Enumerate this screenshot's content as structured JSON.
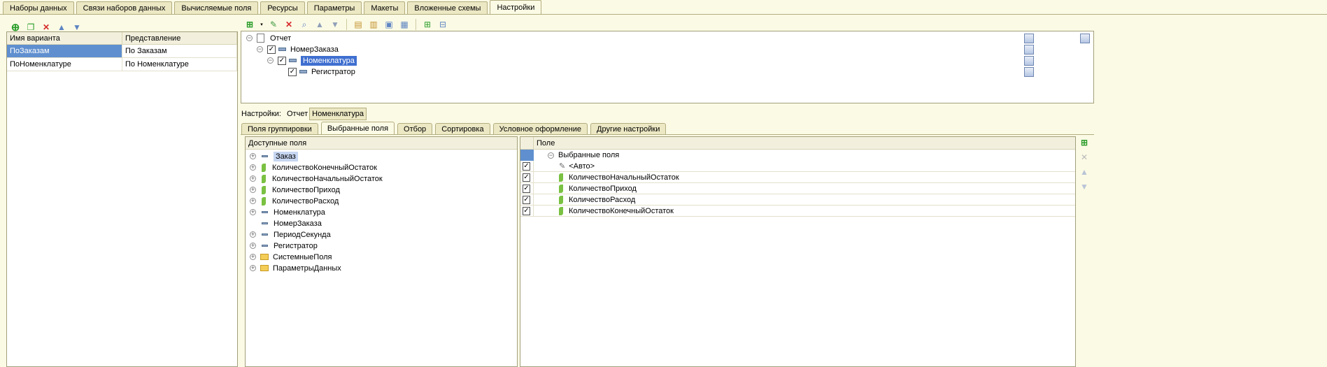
{
  "top_tabs": [
    "Наборы данных",
    "Связи наборов данных",
    "Вычисляемые поля",
    "Ресурсы",
    "Параметры",
    "Макеты",
    "Вложенные схемы",
    "Настройки"
  ],
  "variants": {
    "columns": [
      "Имя варианта",
      "Представление"
    ],
    "rows": [
      {
        "name": "ПоЗаказам",
        "view": "По Заказам",
        "selected": true
      },
      {
        "name": "ПоНоменклатуре",
        "view": "По Номенклатуре",
        "selected": false
      }
    ]
  },
  "structure": {
    "root": "Отчет",
    "items": [
      {
        "label": "НомерЗаказа",
        "checked": true
      },
      {
        "label": "Номенклатура",
        "checked": true,
        "selected": true
      },
      {
        "label": "Регистратор",
        "checked": true
      }
    ]
  },
  "settings_bar": {
    "label": "Настройки:",
    "report": "Отчет",
    "current": "Номенклатура"
  },
  "sub_tabs": [
    "Поля группировки",
    "Выбранные поля",
    "Отбор",
    "Сортировка",
    "Условное оформление",
    "Другие настройки"
  ],
  "available": {
    "header": "Доступные поля",
    "items": [
      {
        "label": "Заказ",
        "icon": "field-icon",
        "expandable": true,
        "selected": true
      },
      {
        "label": "КоличествоКонечныйОстаток",
        "icon": "numeric-icon",
        "expandable": true
      },
      {
        "label": "КоличествоНачальныйОстаток",
        "icon": "numeric-icon",
        "expandable": true
      },
      {
        "label": "КоличествоПриход",
        "icon": "numeric-icon",
        "expandable": true
      },
      {
        "label": "КоличествоРасход",
        "icon": "numeric-icon",
        "expandable": true
      },
      {
        "label": "Номенклатура",
        "icon": "field-icon",
        "expandable": true
      },
      {
        "label": "НомерЗаказа",
        "icon": "field-icon",
        "expandable": false
      },
      {
        "label": "ПериодСекунда",
        "icon": "field-icon",
        "expandable": true
      },
      {
        "label": "Регистратор",
        "icon": "field-icon",
        "expandable": true
      },
      {
        "label": "СистемныеПоля",
        "icon": "folder-icon",
        "expandable": true
      },
      {
        "label": "ПараметрыДанных",
        "icon": "folder-icon",
        "expandable": true
      }
    ]
  },
  "selected_fields": {
    "header": "Поле",
    "group": "Выбранные поля",
    "items": [
      {
        "label": "<Авто>",
        "icon": "auto-icon"
      },
      {
        "label": "КоличествоНачальныйОстаток",
        "icon": "numeric-icon"
      },
      {
        "label": "КоличествоПриход",
        "icon": "numeric-icon"
      },
      {
        "label": "КоличествоРасход",
        "icon": "numeric-icon"
      },
      {
        "label": "КоличествоКонечныйОстаток",
        "icon": "numeric-icon"
      }
    ]
  },
  "colors": {
    "selection": "#5f8fcf",
    "highlight": "#3f6fd0",
    "background": "#fbfae5"
  }
}
